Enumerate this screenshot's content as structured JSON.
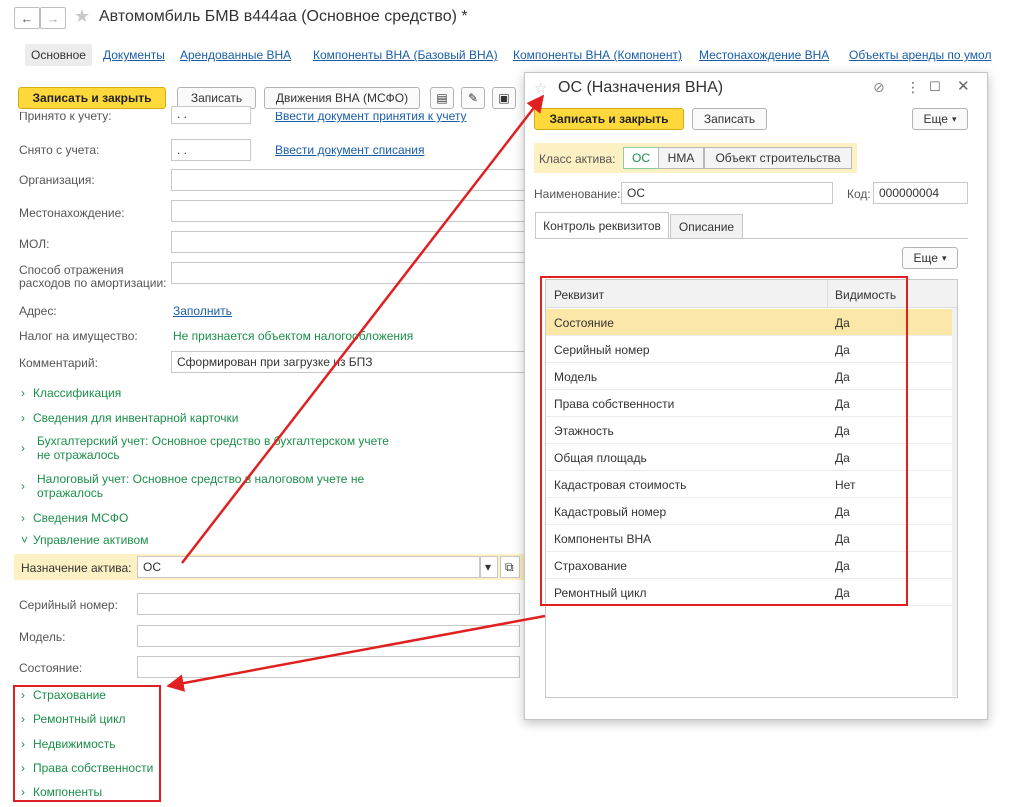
{
  "window": {
    "title": "Автомомбиль БМВ в444аа (Основное средство) *"
  },
  "tabs": [
    {
      "label": "Основное"
    },
    {
      "label": "Документы"
    },
    {
      "label": "Арендованные ВНА"
    },
    {
      "label": "Компоненты ВНА (Базовый ВНА)"
    },
    {
      "label": "Компоненты ВНА (Компонент)"
    },
    {
      "label": "Местонахождение ВНА"
    },
    {
      "label": "Объекты аренды по умол"
    }
  ],
  "toolbar": {
    "save_close": "Записать и закрыть",
    "save": "Записать",
    "movements": "Движения ВНА (МСФО)"
  },
  "form": {
    "accepted_label": "Принято к учету:",
    "accepted_date": ". .",
    "accepted_link": "Ввести документ принятия к учету",
    "removed_label": "Снято с учета:",
    "removed_date": ". .",
    "removed_link": "Ввести документ списания",
    "org_label": "Организация:",
    "location_label": "Местонахождение:",
    "mol_label": "МОЛ:",
    "expense_label_1": "Способ отражения",
    "expense_label_2": "расходов по амортизации:",
    "address_label": "Адрес:",
    "address_link": "Заполнить",
    "tax_label": "Налог на имущество:",
    "tax_value": "Не признается объектом налогообложения",
    "comment_label": "Комментарий:",
    "comment_value": "Сформирован при загрузке из БПЗ",
    "groups": {
      "classification": "Классификация",
      "inventory": "Сведения для инвентарной карточки",
      "accounting_1": "Бухгалтерский учет: Основное средство в бухгалтерском учете",
      "accounting_2": "не отражалось",
      "taxacc_1": "Налоговый учет: Основное средство в налоговом учете не",
      "taxacc_2": "отражалось",
      "ifrs": "Сведения МСФО",
      "asset_mgmt": "Управление активом"
    },
    "purpose_label": "Назначение актива:",
    "purpose_value": "ОС",
    "serial_label": "Серийный номер:",
    "model_label": "Модель:",
    "state_label": "Состояние:",
    "bottom_groups": [
      "Страхование",
      "Ремонтный цикл",
      "Недвижимость",
      "Права собственности",
      "Компоненты"
    ]
  },
  "dialog": {
    "title": "ОС (Назначения ВНА)",
    "save_close": "Записать и закрыть",
    "save": "Записать",
    "more": "Еще",
    "class_label": "Класс актива:",
    "class_options": [
      "ОС",
      "НМА",
      "Объект строительства"
    ],
    "class_selected": "ОС",
    "name_label": "Наименование:",
    "name_value": "ОС",
    "code_label": "Код:",
    "code_value": "000000004",
    "tabs": [
      "Контроль реквизитов",
      "Описание"
    ],
    "table_more": "Еще",
    "columns": [
      "Реквизит",
      "Видимость"
    ],
    "rows": [
      {
        "name": "Состояние",
        "visible": "Да"
      },
      {
        "name": "Серийный номер",
        "visible": "Да"
      },
      {
        "name": "Модель",
        "visible": "Да"
      },
      {
        "name": "Права собственности",
        "visible": "Да"
      },
      {
        "name": "Этажность",
        "visible": "Да"
      },
      {
        "name": "Общая площадь",
        "visible": "Да"
      },
      {
        "name": "Кадастровая стоимость",
        "visible": "Нет"
      },
      {
        "name": "Кадастровый номер",
        "visible": "Да"
      },
      {
        "name": "Компоненты ВНА",
        "visible": "Да"
      },
      {
        "name": "Страхование",
        "visible": "Да"
      },
      {
        "name": "Ремонтный цикл",
        "visible": "Да"
      }
    ]
  },
  "colors": {
    "accent_yellow": "#ffd83b",
    "link_blue": "#1a5ea8",
    "group_green": "#1b8f4a",
    "annotation_red": "#e02020"
  }
}
